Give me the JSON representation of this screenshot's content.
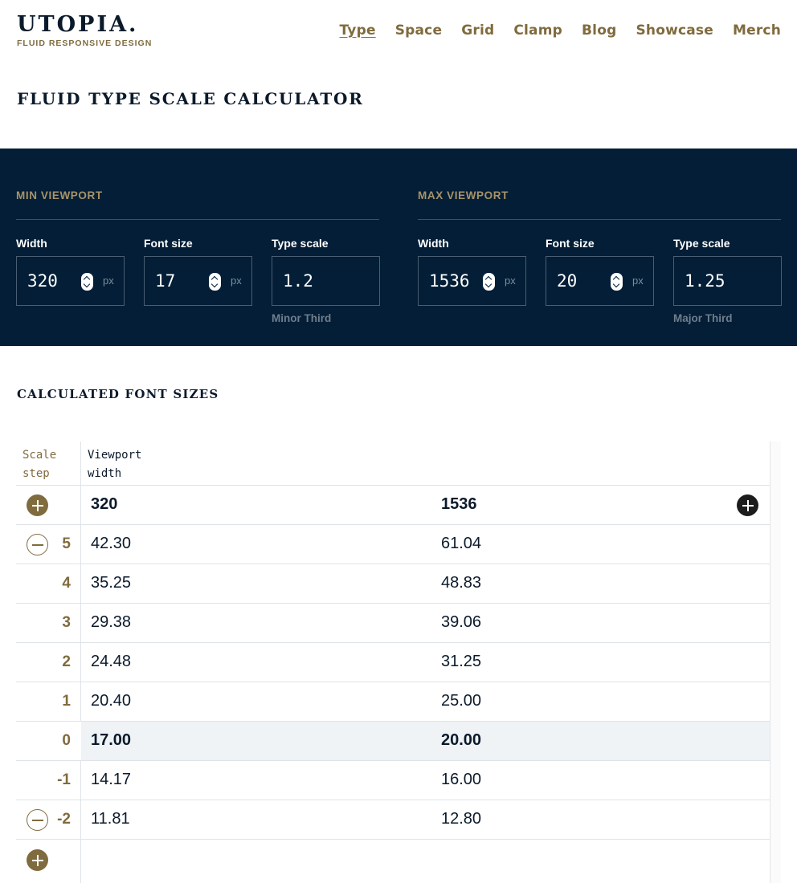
{
  "brand": {
    "name": "UTOPIA.",
    "tagline": "FLUID RESPONSIVE DESIGN"
  },
  "nav": [
    {
      "label": "Type",
      "active": true
    },
    {
      "label": "Space"
    },
    {
      "label": "Grid"
    },
    {
      "label": "Clamp"
    },
    {
      "label": "Blog"
    },
    {
      "label": "Showcase"
    },
    {
      "label": "Merch"
    }
  ],
  "page_title": "FLUID TYPE SCALE CALCULATOR",
  "min_viewport": {
    "heading": "MIN VIEWPORT",
    "width_label": "Width",
    "width_value": "320",
    "width_unit": "px",
    "font_label": "Font size",
    "font_value": "17",
    "font_unit": "px",
    "scale_label": "Type scale",
    "scale_value": "1.2",
    "scale_name": "Minor Third"
  },
  "max_viewport": {
    "heading": "MAX VIEWPORT",
    "width_label": "Width",
    "width_value": "1536",
    "width_unit": "px",
    "font_label": "Font size",
    "font_value": "20",
    "font_unit": "px",
    "scale_label": "Type scale",
    "scale_value": "1.25",
    "scale_name": "Major Third"
  },
  "calc_title": "CALCULATED FONT SIZES",
  "table": {
    "head_step": [
      "Scale",
      "step"
    ],
    "head_viewport": [
      "Viewport",
      "width"
    ],
    "viewport_min": "320",
    "viewport_max": "1536",
    "rows": [
      {
        "step": "5",
        "min": "42.30",
        "max": "61.04"
      },
      {
        "step": "4",
        "min": "35.25",
        "max": "48.83"
      },
      {
        "step": "3",
        "min": "29.38",
        "max": "39.06"
      },
      {
        "step": "2",
        "min": "24.48",
        "max": "31.25"
      },
      {
        "step": "1",
        "min": "20.40",
        "max": "25.00"
      },
      {
        "step": "0",
        "min": "17.00",
        "max": "20.00"
      },
      {
        "step": "-1",
        "min": "14.17",
        "max": "16.00"
      },
      {
        "step": "-2",
        "min": "11.81",
        "max": "12.80"
      }
    ]
  },
  "icons": {
    "add_step_top": "plus-circle-icon",
    "remove_step_top": "minus-circle-icon",
    "add_viewport": "plus-circle-icon",
    "remove_step_bottom": "minus-circle-icon",
    "add_step_bottom": "plus-circle-icon"
  },
  "colors": {
    "navy": "#031e36",
    "gold": "#806b3e",
    "highlight": "#eff3f6"
  }
}
